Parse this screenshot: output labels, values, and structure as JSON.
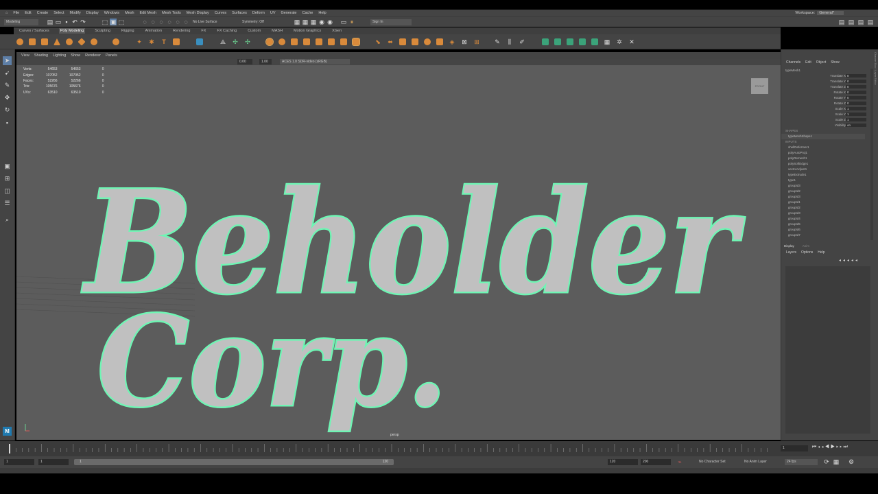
{
  "menu": [
    "File",
    "Edit",
    "Create",
    "Select",
    "Modify",
    "Display",
    "Windows",
    "Mesh",
    "Edit Mesh",
    "Mesh Tools",
    "Mesh Display",
    "Curves",
    "Surfaces",
    "Deform",
    "UV",
    "Generate",
    "Cache",
    "Help"
  ],
  "workspace_label": "Workspace:",
  "workspace_value": "General*",
  "status": {
    "mode": "Modeling",
    "live_surface": "No Live Surface",
    "symmetry": "Symmetry: Off",
    "sign_in": "Sign In"
  },
  "shelf_tabs": [
    "Curves / Surfaces",
    "Poly Modeling",
    "Sculpting",
    "Rigging",
    "Animation",
    "Rendering",
    "FX",
    "FX Caching",
    "Custom",
    "MASH",
    "Motion Graphics",
    "XGen"
  ],
  "shelf_active": "Poly Modeling",
  "panel_menu": [
    "View",
    "Shading",
    "Lighting",
    "Show",
    "Renderer",
    "Panels"
  ],
  "panel_tools": {
    "exposure": "0.00",
    "gamma": "1.00",
    "color_space": "ACES 1.0 SDR-video (sRGB)"
  },
  "hud": [
    {
      "label": "Verts:",
      "a": "54653",
      "b": "54653",
      "c": "0"
    },
    {
      "label": "Edges:",
      "a": "107052",
      "b": "107052",
      "c": "0"
    },
    {
      "label": "Faces:",
      "a": "52266",
      "b": "52266",
      "c": "0"
    },
    {
      "label": "Tris:",
      "a": "105676",
      "b": "105676",
      "c": "0"
    },
    {
      "label": "UVs:",
      "a": "63510",
      "b": "63510",
      "c": "0"
    }
  ],
  "viewcube_label": "FRONT",
  "camera": "persp",
  "text_line1": "Beholder",
  "text_line2": "Corp.",
  "colors": {
    "outline": "#6ff5b4",
    "fill": "#c0c0c0",
    "viewport": "#5c5c5c"
  },
  "channel_box": {
    "menu": [
      "Channels",
      "Edit",
      "Object",
      "Show"
    ],
    "object": "typeMesh1",
    "attrs": [
      {
        "name": "Translate X",
        "value": "0"
      },
      {
        "name": "Translate Y",
        "value": "0"
      },
      {
        "name": "Translate Z",
        "value": "0"
      },
      {
        "name": "Rotate X",
        "value": "0"
      },
      {
        "name": "Rotate Y",
        "value": "0"
      },
      {
        "name": "Rotate Z",
        "value": "0"
      },
      {
        "name": "Scale X",
        "value": "1"
      },
      {
        "name": "Scale Y",
        "value": "1"
      },
      {
        "name": "Scale Z",
        "value": "1"
      },
      {
        "name": "Visibility",
        "value": "on"
      }
    ],
    "shapes_head": "SHAPES",
    "shape": "typeMeshShape1",
    "inputs_head": "INPUTS",
    "inputs": [
      "shellDeformer1",
      "polyAutoProj1",
      "polyRemesh1",
      "polySoftEdge1",
      "vectorAdjust1",
      "typeExtrude1",
      "type1",
      "groupId3",
      "groupId2",
      "groupId3",
      "groupId1",
      "groupId2",
      "groupId3",
      "groupId4",
      "groupId5",
      "groupId6",
      "groupId7"
    ]
  },
  "layer_editor": {
    "tabs": [
      "Display",
      "Anim"
    ],
    "menu": [
      "Layers",
      "Options",
      "Help"
    ]
  },
  "range": {
    "start": "1",
    "current": "1",
    "slider_start": "1",
    "slider_end": "120",
    "end": "120",
    "max": "200",
    "frame_field": "1"
  },
  "bottom": {
    "char_set": "No Character Set",
    "anim_layer": "No Anim Layer",
    "fps": "24 fps"
  },
  "side_tabs": [
    "Channel Box / Layer Editor",
    "Attribute Editor",
    "Modeling Toolkit"
  ]
}
